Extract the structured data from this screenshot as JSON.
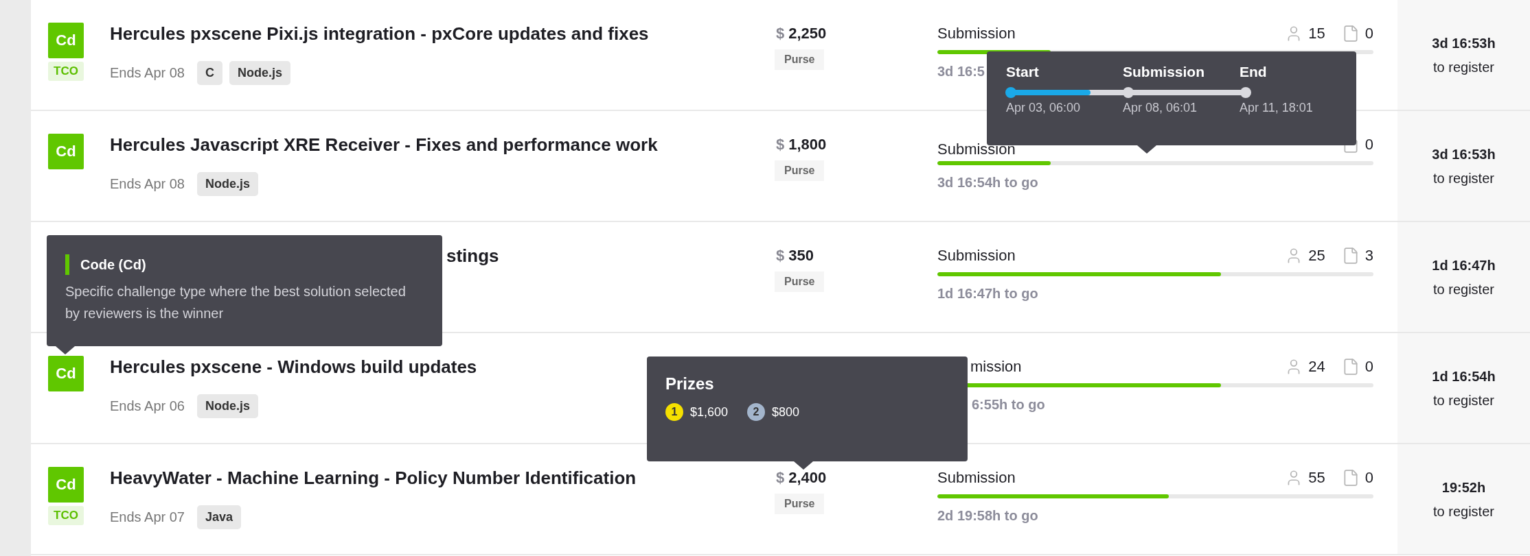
{
  "rows": [
    {
      "type_badge": "Cd",
      "tco_badge": "TCO",
      "title": "Hercules pxscene Pixi.js integration - pxCore updates and fixes",
      "ends": "Ends Apr 08",
      "tags": [
        "C",
        "Node.js"
      ],
      "currency": "$",
      "prize": "2,250",
      "prize_label": "Purse",
      "phase": "Submission",
      "level": 0.26,
      "time_left": "3d 16:5",
      "registrants": "15",
      "submissions": "0",
      "register_time": "3d 16:53h",
      "register_label": "to register"
    },
    {
      "type_badge": "Cd",
      "title": "Hercules Javascript XRE Receiver - Fixes and performance work",
      "ends": "Ends Apr 08",
      "tags": [
        "Node.js"
      ],
      "currency": "$",
      "prize": "1,800",
      "prize_label": "Purse",
      "phase": "Submission",
      "level": 0.26,
      "time_left": "3d 16:54h to go",
      "submissions": "0",
      "register_time": "3d 16:53h",
      "register_label": "to register"
    },
    {
      "title": "stings",
      "currency": "$",
      "prize": "350",
      "prize_label": "Purse",
      "phase": "Submission",
      "level": 0.65,
      "time_left": "1d 16:47h to go",
      "registrants": "25",
      "submissions": "3",
      "register_time": "1d 16:47h",
      "register_label": "to register"
    },
    {
      "type_badge": "Cd",
      "title": "Hercules pxscene - Windows build updates",
      "ends": "Ends Apr 06",
      "tags": [
        "Node.js"
      ],
      "phase": "mission",
      "level": 0.65,
      "time_left": "6:55h to go",
      "registrants": "24",
      "submissions": "0",
      "register_time": "1d 16:54h",
      "register_label": "to register"
    },
    {
      "type_badge": "Cd",
      "tco_badge": "TCO",
      "title": "HeavyWater - Machine Learning - Policy Number Identification",
      "ends": "Ends Apr 07",
      "tags": [
        "Java"
      ],
      "currency": "$",
      "prize": "2,400",
      "prize_label": "Purse",
      "phase": "Submission",
      "level": 0.53,
      "time_left": "2d 19:58h to go",
      "registrants": "55",
      "submissions": "0",
      "register_time": "19:52h",
      "register_label": "to register"
    }
  ],
  "timeline_tooltip": {
    "level": 0.34,
    "points": [
      {
        "label": "Start",
        "date": "Apr 03, 06:00"
      },
      {
        "label": "Submission",
        "date": "Apr 08, 06:01"
      },
      {
        "label": "End",
        "date": "Apr 11, 18:01"
      }
    ]
  },
  "type_tooltip": {
    "title": "Code (Cd)",
    "description": "Specific challenge type where the best solution selected by reviewers is the winner"
  },
  "prizes_tooltip": {
    "title": "Prizes",
    "prizes": [
      {
        "place": "1",
        "amount": "$1,600",
        "color": "#f5e000"
      },
      {
        "place": "2",
        "amount": "$800",
        "color": "#a3b5cc"
      }
    ]
  }
}
